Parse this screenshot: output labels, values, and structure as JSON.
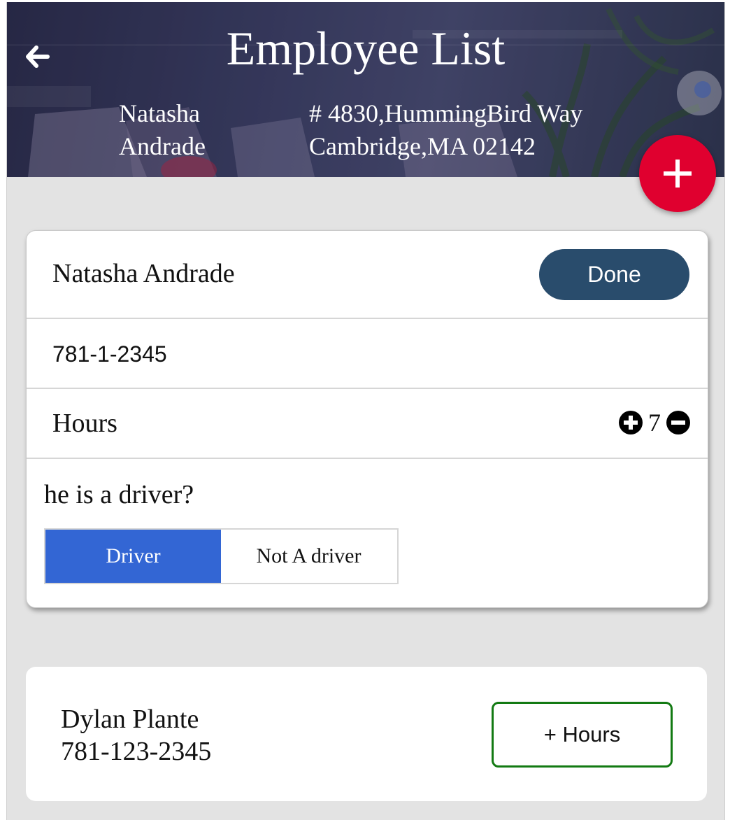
{
  "header": {
    "title": "Employee List",
    "owner_first": "Natasha",
    "owner_last": "Andrade",
    "address_line1": "# 4830,HummingBird Way",
    "address_line2": "Cambridge,MA 02142"
  },
  "icons": {
    "back": "arrow-left-icon",
    "add": "plus-icon",
    "increment": "plus-circle-icon",
    "decrement": "minus-circle-icon"
  },
  "colors": {
    "fab": "#e0002f",
    "done_button": "#294c6c",
    "segment_selected": "#3366d4",
    "hours_button_border": "#137a13"
  },
  "expanded_card": {
    "name": "Natasha Andrade",
    "done_label": "Done",
    "phone": "781-1-2345",
    "hours_label": "Hours",
    "hours_value": "7",
    "question": "he is a driver?",
    "options": [
      "Driver",
      "Not A driver"
    ],
    "selected_option": "Driver"
  },
  "employee_card": {
    "name": "Dylan Plante",
    "phone": "781-123-2345",
    "hours_button_label": "+ Hours"
  }
}
